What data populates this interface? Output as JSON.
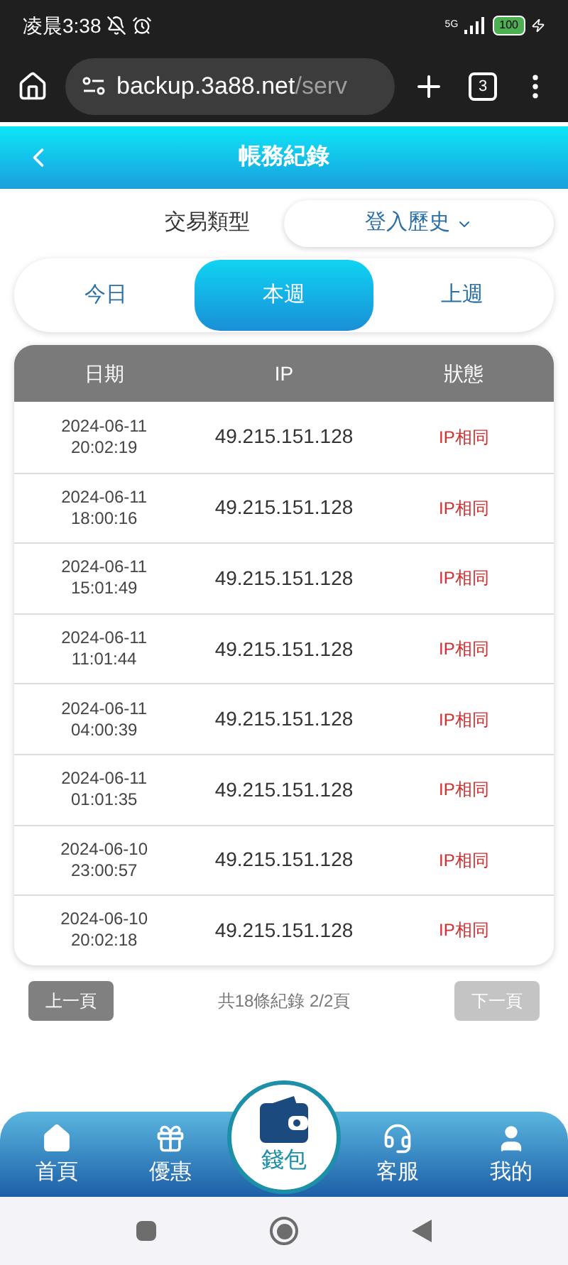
{
  "status_bar": {
    "time": "凌晨3:38",
    "network": "5G",
    "battery": "100"
  },
  "browser": {
    "url_host": "backup.3a88.net",
    "url_path": "/serv",
    "tab_count": "3"
  },
  "header": {
    "title": "帳務紀錄"
  },
  "filter": {
    "label": "交易類型",
    "value": "登入歷史"
  },
  "tabs": [
    {
      "label": "今日",
      "selected": false
    },
    {
      "label": "本週",
      "selected": true
    },
    {
      "label": "上週",
      "selected": false
    }
  ],
  "table": {
    "columns": [
      "日期",
      "IP",
      "狀態"
    ],
    "rows": [
      {
        "date": "2024-06-11",
        "time": "20:02:19",
        "ip": "49.215.151.128",
        "status": "IP相同"
      },
      {
        "date": "2024-06-11",
        "time": "18:00:16",
        "ip": "49.215.151.128",
        "status": "IP相同"
      },
      {
        "date": "2024-06-11",
        "time": "15:01:49",
        "ip": "49.215.151.128",
        "status": "IP相同"
      },
      {
        "date": "2024-06-11",
        "time": "11:01:44",
        "ip": "49.215.151.128",
        "status": "IP相同"
      },
      {
        "date": "2024-06-11",
        "time": "04:00:39",
        "ip": "49.215.151.128",
        "status": "IP相同"
      },
      {
        "date": "2024-06-11",
        "time": "01:01:35",
        "ip": "49.215.151.128",
        "status": "IP相同"
      },
      {
        "date": "2024-06-10",
        "time": "23:00:57",
        "ip": "49.215.151.128",
        "status": "IP相同"
      },
      {
        "date": "2024-06-10",
        "time": "20:02:18",
        "ip": "49.215.151.128",
        "status": "IP相同"
      }
    ]
  },
  "pagination": {
    "prev": {
      "label": "上一頁",
      "disabled": false
    },
    "summary": "共18條紀錄 2/2頁",
    "next": {
      "label": "下一頁",
      "disabled": true
    }
  },
  "bottom_nav": [
    {
      "kind": "home",
      "label": "首頁"
    },
    {
      "kind": "gift",
      "label": "優惠"
    },
    {
      "kind": "wallet",
      "label": "錢包"
    },
    {
      "kind": "support",
      "label": "客服"
    },
    {
      "kind": "user",
      "label": "我的"
    }
  ]
}
